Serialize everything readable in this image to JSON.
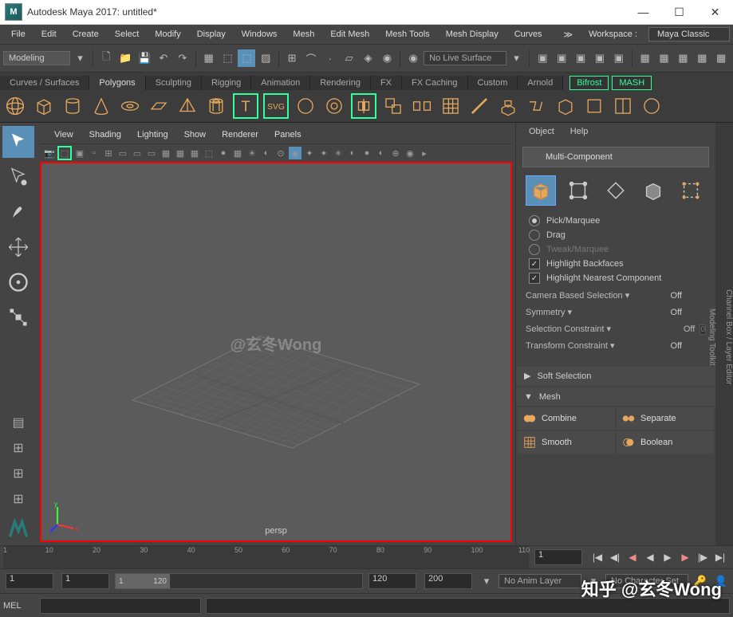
{
  "window": {
    "title": "Autodesk Maya 2017: untitled*",
    "logo": "M"
  },
  "menus": [
    "File",
    "Edit",
    "Create",
    "Select",
    "Modify",
    "Display",
    "Windows",
    "Mesh",
    "Edit Mesh",
    "Mesh Tools",
    "Mesh Display",
    "Curves"
  ],
  "workspace": {
    "label": "Workspace :",
    "value": "Maya Classic",
    "more": "≫"
  },
  "moduleSelect": "Modeling",
  "liveSurface": "No Live Surface",
  "shelfTabs": [
    {
      "label": "Curves / Surfaces"
    },
    {
      "label": "Polygons",
      "active": true
    },
    {
      "label": "Sculpting"
    },
    {
      "label": "Rigging"
    },
    {
      "label": "Animation"
    },
    {
      "label": "Rendering"
    },
    {
      "label": "FX"
    },
    {
      "label": "FX Caching"
    },
    {
      "label": "Custom"
    },
    {
      "label": "Arnold"
    }
  ],
  "bifrost": "Bifrost",
  "mash": "MASH",
  "vpMenus": [
    "View",
    "Shading",
    "Lighting",
    "Show",
    "Renderer",
    "Panels"
  ],
  "watermark": "@玄冬Wong",
  "camera": "persp",
  "rpanelMenus": [
    "Object",
    "Help"
  ],
  "multiComp": "Multi-Component",
  "radios": {
    "pick": "Pick/Marquee",
    "drag": "Drag",
    "tweak": "Tweak/Marquee"
  },
  "checks": {
    "hb": "Highlight Backfaces",
    "hn": "Highlight Nearest Component"
  },
  "rows": {
    "cbs": {
      "l": "Camera Based Selection",
      "v": "Off"
    },
    "sym": {
      "l": "Symmetry",
      "v": "Off"
    },
    "sc": {
      "l": "Selection Constraint",
      "v": "Off",
      "n": "0"
    },
    "tc": {
      "l": "Transform Constraint",
      "v": "Off"
    }
  },
  "sections": {
    "ss": "Soft Selection",
    "mesh": "Mesh"
  },
  "meshBtns": {
    "combine": "Combine",
    "separate": "Separate",
    "smooth": "Smooth",
    "boolean": "Boolean"
  },
  "sideTabs": [
    "Channel Box / Layer Editor",
    "Modeling Toolkit"
  ],
  "timeTicks": [
    1,
    10,
    20,
    30,
    40,
    50,
    60,
    70,
    80,
    90,
    100,
    110
  ],
  "frames": {
    "cur": "1",
    "s": "1",
    "e": "1",
    "sr": "1",
    "er": "120",
    "r1": "120",
    "r2": "200"
  },
  "anim": {
    "layer": "No Anim Layer",
    "char": "No Character Set"
  },
  "cmd": "MEL",
  "credit": "知乎 @玄冬Wong"
}
